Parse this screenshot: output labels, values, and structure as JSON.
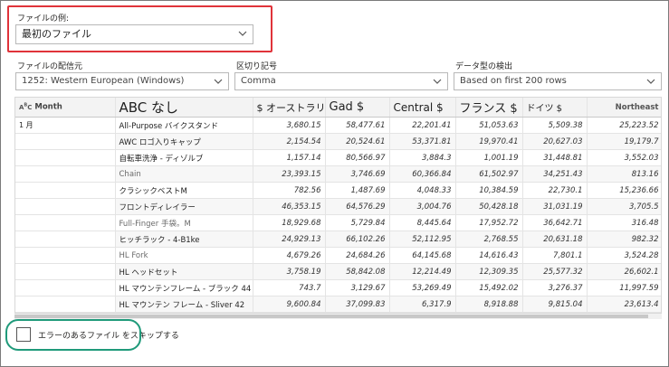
{
  "file_example": {
    "label": "ファイルの例:",
    "value": "最初のファイル"
  },
  "file_origin": {
    "label": "ファイルの配信元",
    "value": "1252: Western European (Windows)"
  },
  "delimiter": {
    "label": "区切り記号",
    "value": "Comma"
  },
  "data_type_detection": {
    "label": "データ型の検出",
    "value": "Based on first 200 rows"
  },
  "table": {
    "headers": {
      "month": "Month",
      "product": "ABC なし",
      "australia": "$ オーストラリア $",
      "gad": "Gad $",
      "central": "Central $",
      "france": "フランス $",
      "germany": "ドイツ $",
      "northeast": "Northeast"
    },
    "rows": [
      {
        "month": "1 月",
        "product": "All-Purpose バイクスタンド",
        "australia": "3,680.15",
        "gad": "58,477.61",
        "central": "22,201.41",
        "france": "51,053.63",
        "germany": "5,509.38",
        "northeast": "25,223.52"
      },
      {
        "month": "",
        "product": "AWC ロゴ入りキャップ",
        "australia": "2,154.54",
        "gad": "20,524.61",
        "central": "53,371.81",
        "france": "19,970.41",
        "germany": "20,627.03",
        "northeast": "19,179.7"
      },
      {
        "month": "",
        "product": "自転車洗浄 - ディゾルブ",
        "australia": "1,157.14",
        "gad": "80,566.97",
        "central": "3,884.3",
        "france": "1,001.19",
        "germany": "31,448.81",
        "northeast": "3,552.03"
      },
      {
        "month": "",
        "product": "Chain",
        "australia": "23,393.15",
        "gad": "3,746.69",
        "central": "60,366.84",
        "france": "61,502.97",
        "germany": "34,251.43",
        "northeast": "813.16"
      },
      {
        "month": "",
        "product": "クラシックベストM",
        "australia": "782.56",
        "gad": "1,487.69",
        "central": "4,048.33",
        "france": "10,384.59",
        "germany": "22,730.1",
        "northeast": "15,236.66"
      },
      {
        "month": "",
        "product": "フロントディレイラー",
        "australia": "46,353.15",
        "gad": "64,576.29",
        "central": "3,004.76",
        "france": "50,428.18",
        "germany": "31,031.19",
        "northeast": "3,705.5"
      },
      {
        "month": "",
        "product": "Full-Finger 手袋。M",
        "australia": "18,929.68",
        "gad": "5,729.84",
        "central": "8,445.64",
        "france": "17,952.72",
        "germany": "36,642.71",
        "northeast": "316.48"
      },
      {
        "month": "",
        "product": "ヒッチラック - 4-B1ke",
        "australia": "24,929.13",
        "gad": "66,102.26",
        "central": "52,112.95",
        "france": "2,768.55",
        "germany": "20,631.18",
        "northeast": "982.32"
      },
      {
        "month": "",
        "product": "HL Fork",
        "australia": "4,679.26",
        "gad": "24,684.26",
        "central": "64,145.68",
        "france": "14,616.43",
        "germany": "7,801.1",
        "northeast": "3,524.28"
      },
      {
        "month": "",
        "product": "HL ヘッドセット",
        "australia": "3,758.19",
        "gad": "58,842.08",
        "central": "12,214.49",
        "france": "12,309.35",
        "germany": "25,577.32",
        "northeast": "26,602.1"
      },
      {
        "month": "",
        "product": "HL マウンテンフレーム - ブラック 44",
        "australia": "743.7",
        "gad": "3,129.67",
        "central": "53,269.49",
        "france": "15,492.02",
        "germany": "3,276.37",
        "northeast": "11,997.59"
      },
      {
        "month": "",
        "product": "HL マウンテン フレーム - Sliver 42",
        "australia": "9,600.84",
        "gad": "37,099.83",
        "central": "6,317.9",
        "france": "8,918.88",
        "germany": "9,815.04",
        "northeast": "23,613.4"
      }
    ]
  },
  "skip_errors": {
    "label": "エラーのあるファイル をスキップする",
    "checked": false
  },
  "colors": {
    "highlight_red": "#e0333a",
    "highlight_green": "#1f9a7a"
  }
}
